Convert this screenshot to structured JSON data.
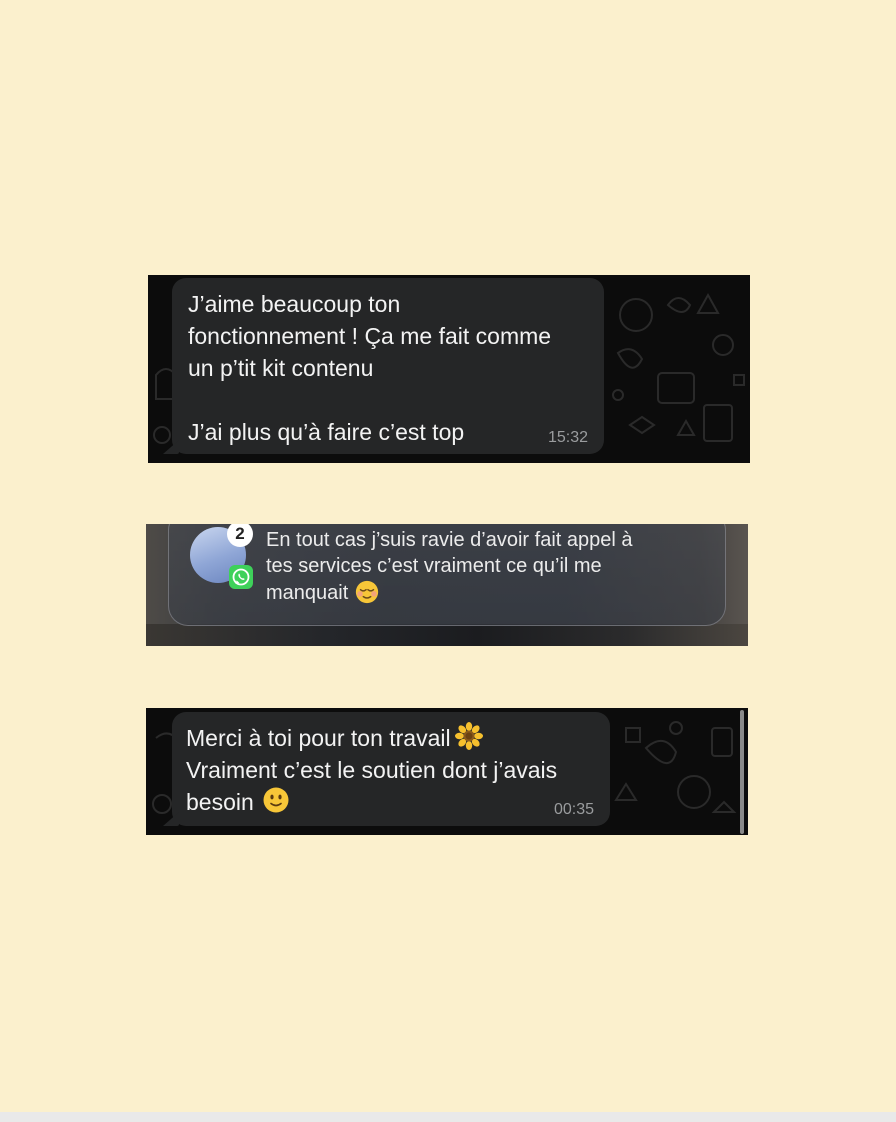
{
  "message1": {
    "lines": [
      "J’aime beaucoup ton",
      "fonctionnement ! Ça me fait comme",
      "un p’tit kit contenu",
      "J’ai plus qu’à faire c’est top"
    ],
    "time": "15:32"
  },
  "notification": {
    "badge_count": "2",
    "app_icon": "whatsapp-icon",
    "lines": [
      "En tout cas j’suis ravie d’avoir fait appel à",
      "tes services c’est vraiment ce qu’il me",
      "manquait"
    ],
    "emoji": "relieved-smile-emoji"
  },
  "message3": {
    "lines": [
      "Merci à toi pour ton travail",
      "Vraiment c’est le soutien dont j’avais",
      "besoin"
    ],
    "emojis": [
      "sunflower-emoji",
      "slight-smile-emoji"
    ],
    "time": "00:35"
  },
  "colors": {
    "page_background": "#fbf0cd",
    "chat_background": "#0c0c0c",
    "bubble_incoming": "#252627",
    "timestamp": "#9a9c9e",
    "whatsapp_green": "#3ed15a"
  }
}
